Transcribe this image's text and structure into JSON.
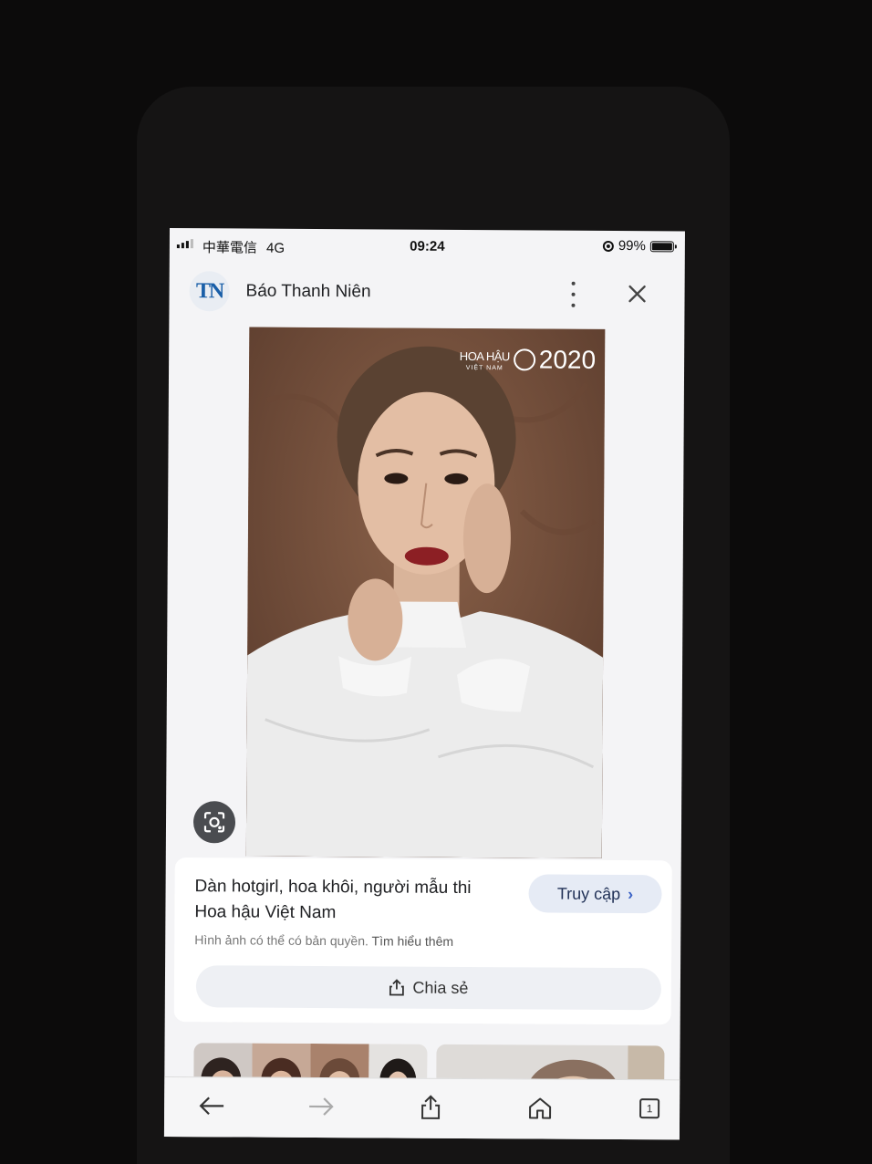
{
  "status_bar": {
    "carrier": "中華電信",
    "network": "4G",
    "time": "09:24",
    "battery": "99%",
    "battery_level": 0.99
  },
  "header": {
    "logo_text": "TN",
    "site_name": "Báo Thanh Niên"
  },
  "image": {
    "watermark_brand": "HOA HẬU",
    "watermark_sub": "VIỆT NAM",
    "watermark_year": "2020"
  },
  "result": {
    "title": "Dàn hotgirl, hoa khôi, người mẫu thi Hoa hậu Việt Nam",
    "visit_label": "Truy cập",
    "copyright_text": "Hình ảnh có thể có bản quyền.",
    "learn_more": "Tìm hiểu thêm",
    "share_label": "Chia sẻ"
  },
  "toolbar": {
    "tab_count": "1"
  },
  "colors": {
    "accent_blue": "#1a5fa8",
    "visit_button_bg": "#e6ebf5",
    "photo_background": "#7b5541"
  },
  "icons": [
    "signal-icon",
    "orientation-lock-icon",
    "battery-icon",
    "more-vertical-icon",
    "close-icon",
    "google-lens-icon",
    "chevron-right-icon",
    "share-icon",
    "back-arrow-icon",
    "forward-arrow-icon",
    "home-icon",
    "tabs-icon"
  ]
}
